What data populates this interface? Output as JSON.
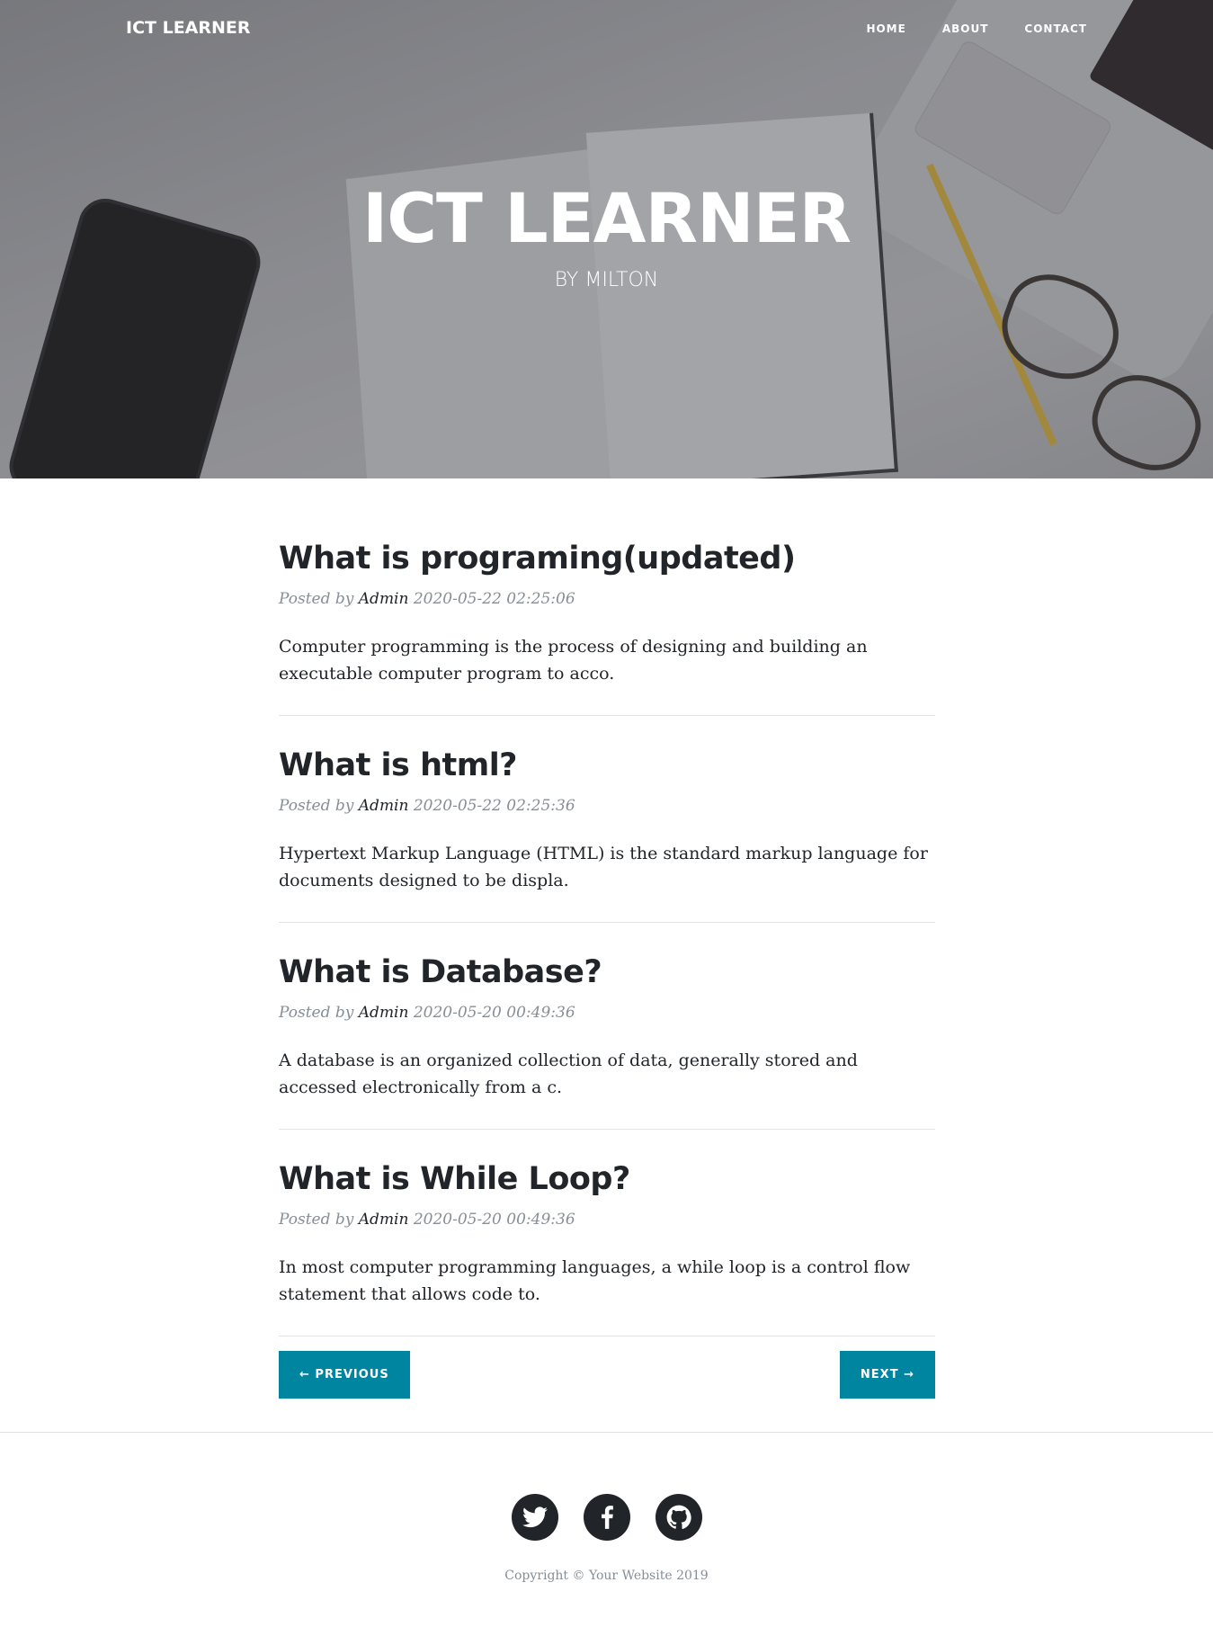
{
  "header": {
    "brand": "ICT LEARNER",
    "nav": [
      {
        "label": "HOME"
      },
      {
        "label": "ABOUT"
      },
      {
        "label": "CONTACT"
      }
    ],
    "title": "ICT LEARNER",
    "subtitle": "BY MILTON"
  },
  "posts": [
    {
      "title": "What is programing(updated)",
      "posted_by_label": "Posted by",
      "author": "Admin",
      "date": "2020-05-22 02:25:06",
      "excerpt": "Computer programming is the process of designing and building an executable computer program to acco."
    },
    {
      "title": "What is html?",
      "posted_by_label": "Posted by",
      "author": "Admin",
      "date": "2020-05-22 02:25:36",
      "excerpt": "Hypertext Markup Language (HTML) is the standard markup language for documents designed to be displa."
    },
    {
      "title": "What is Database?",
      "posted_by_label": "Posted by",
      "author": "Admin",
      "date": "2020-05-20 00:49:36",
      "excerpt": "A database is an organized collection of data, generally stored and accessed electronically from a c."
    },
    {
      "title": "What is While Loop?",
      "posted_by_label": "Posted by",
      "author": "Admin",
      "date": "2020-05-20 00:49:36",
      "excerpt": "In most computer programming languages, a while loop is a control flow statement that allows code to."
    }
  ],
  "pager": {
    "previous": "← PREVIOUS",
    "next": "NEXT →"
  },
  "footer": {
    "social": [
      {
        "icon": "twitter-icon"
      },
      {
        "icon": "facebook-icon"
      },
      {
        "icon": "github-icon"
      }
    ],
    "copyright": "Copyright © Your Website 2019"
  },
  "colors": {
    "accent": "#0085a1",
    "text": "#212529",
    "muted": "#868e96"
  }
}
